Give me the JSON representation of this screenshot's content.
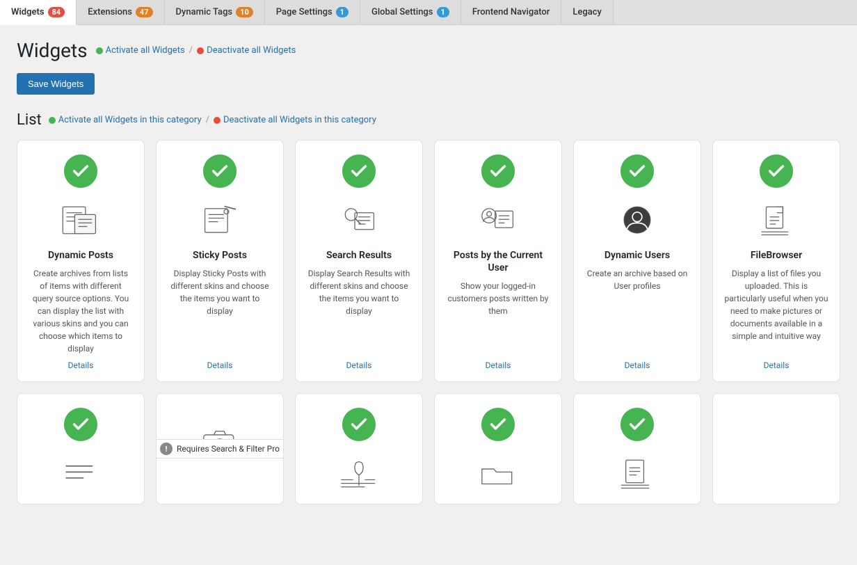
{
  "tabs": [
    {
      "id": "widgets",
      "label": "Widgets",
      "badge": "84",
      "active": true
    },
    {
      "id": "extensions",
      "label": "Extensions",
      "badge": "47",
      "active": false
    },
    {
      "id": "dynamic-tags",
      "label": "Dynamic Tags",
      "badge": "10",
      "active": false
    },
    {
      "id": "page-settings",
      "label": "Page Settings",
      "badge": "1",
      "active": false
    },
    {
      "id": "global-settings",
      "label": "Global Settings",
      "badge": "1",
      "active": false
    },
    {
      "id": "frontend-navigator",
      "label": "Frontend Navigator",
      "badge": null,
      "active": false
    },
    {
      "id": "legacy",
      "label": "Legacy",
      "badge": null,
      "active": false
    }
  ],
  "page": {
    "title": "Widgets",
    "activate_all_label": "Activate all Widgets",
    "deactivate_all_label": "Deactivate all Widgets",
    "save_label": "Save Widgets"
  },
  "list_section": {
    "title": "List",
    "activate_category_label": "Activate all Widgets in this category",
    "deactivate_category_label": "Deactivate all Widgets in this category"
  },
  "widgets_row1": [
    {
      "id": "dynamic-posts",
      "name": "Dynamic Posts",
      "desc": "Create archives from lists of items with different query source options. You can display the list with various skins and you can choose which items to display",
      "details_label": "Details",
      "enabled": true,
      "icon": "dynamic-posts"
    },
    {
      "id": "sticky-posts",
      "name": "Sticky Posts",
      "desc": "Display Sticky Posts with different skins and choose the items you want to display",
      "details_label": "Details",
      "enabled": true,
      "icon": "sticky-posts"
    },
    {
      "id": "search-results",
      "name": "Search Results",
      "desc": "Display Search Results with different skins and choose the items you want to display",
      "details_label": "Details",
      "enabled": true,
      "icon": "search-results"
    },
    {
      "id": "posts-by-current-user",
      "name": "Posts by the Current User",
      "desc": "Show your logged-in customers posts written by them",
      "details_label": "Details",
      "enabled": true,
      "icon": "posts-current-user"
    },
    {
      "id": "dynamic-users",
      "name": "Dynamic Users",
      "desc": "Create an archive based on User profiles",
      "details_label": "Details",
      "enabled": true,
      "icon": "dynamic-users"
    },
    {
      "id": "filebrowser",
      "name": "FileBrowser",
      "desc": "Display a list of files you uploaded. This is particularly useful when you need to make pictures or documents available in a simple and intuitive way",
      "details_label": "Details",
      "enabled": true,
      "icon": "filebrowser"
    }
  ],
  "widgets_row2": [
    {
      "id": "row2-1",
      "name": "",
      "desc": "",
      "enabled": true,
      "icon": "list-widget",
      "requires": null
    },
    {
      "id": "row2-2",
      "name": "",
      "desc": "",
      "enabled": false,
      "icon": "camera-widget",
      "requires": "Requires Search & Filter Pro"
    },
    {
      "id": "row2-3",
      "name": "",
      "desc": "",
      "enabled": true,
      "icon": "pin-widget",
      "requires": null
    },
    {
      "id": "row2-4",
      "name": "",
      "desc": "",
      "enabled": true,
      "icon": "folder-widget",
      "requires": null
    },
    {
      "id": "row2-5",
      "name": "",
      "desc": "",
      "enabled": true,
      "icon": "doc-widget",
      "requires": null
    },
    {
      "id": "row2-6",
      "name": "",
      "desc": "",
      "enabled": false,
      "icon": "empty",
      "requires": null
    }
  ]
}
